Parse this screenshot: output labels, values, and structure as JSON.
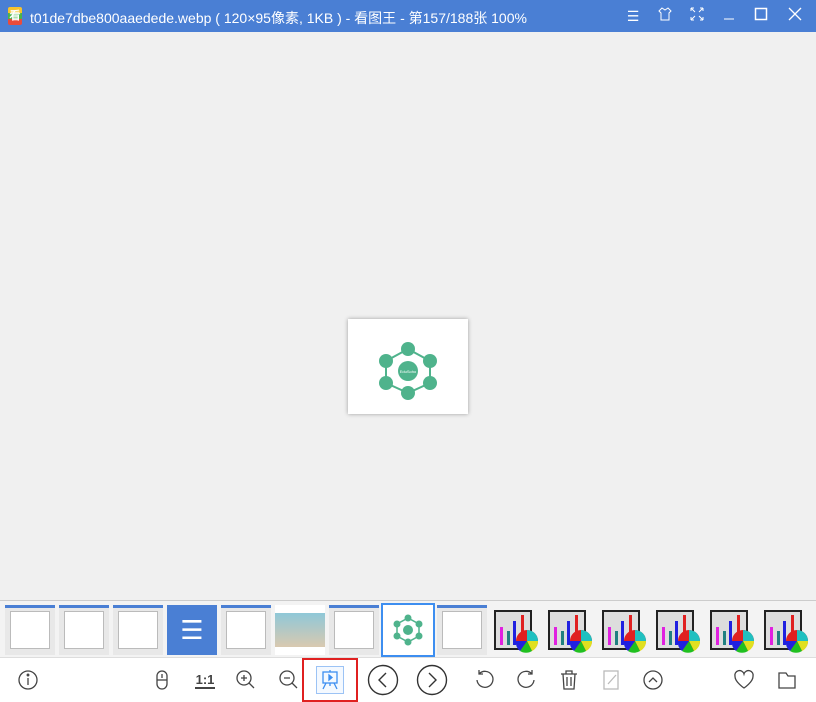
{
  "window": {
    "app_icon_glyph": "看",
    "title": "t01de7dbe800aaedede.webp ( 120×95像素, 1KB ) - 看图王 - 第157/188张 100%"
  },
  "window_buttons": [
    "menu-icon",
    "skin-icon",
    "fullscreen-icon",
    "minimize-icon",
    "maximize-icon",
    "close-icon"
  ],
  "image": {
    "center_label": "EduSoho",
    "node_count": 6
  },
  "thumbnails": {
    "count": 15,
    "selected_index": 7
  },
  "toolbar": {
    "actual_size_label": "1:1"
  },
  "colors": {
    "titlebar": "#4a7fd4",
    "selection": "#3d8ef0",
    "highlight": "#e02020",
    "mindmap": "#4fb38c"
  }
}
